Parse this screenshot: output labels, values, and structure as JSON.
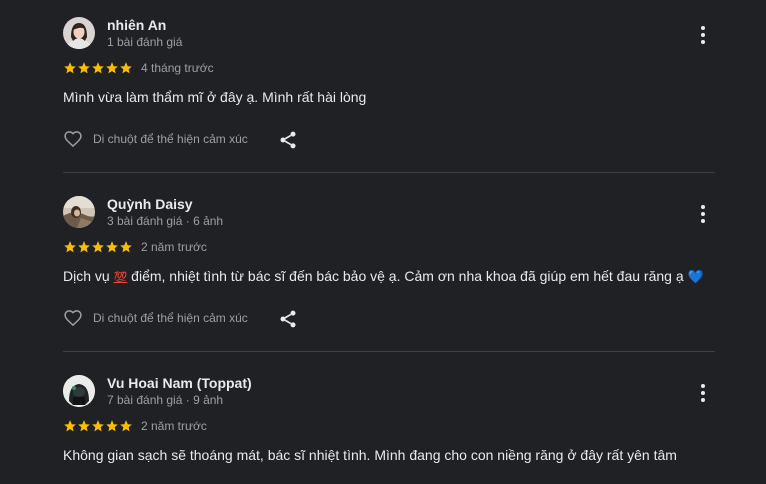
{
  "reviews": [
    {
      "author": "nhiên An",
      "meta": "1 bài đánh giá",
      "rating": 5,
      "date": "4 tháng trước",
      "text": "Mình vừa làm thẩm mĩ ở đây ạ. Mình rất hài lòng",
      "like_label": "Di chuột để thể hiện cảm xúc"
    },
    {
      "author": "Quỳnh Daisy",
      "meta": "3 bài đánh giá · 6 ảnh",
      "rating": 5,
      "date": "2 năm trước",
      "text_before": "Dịch vụ ",
      "emoji_1": "💯",
      "text_after": " điểm, nhiệt tình từ bác sĩ đến bác bảo vệ ạ. Cảm ơn nha khoa đã giúp em hết đau răng ạ ",
      "emoji_2": "💙",
      "like_label": "Di chuột để thể hiện cảm xúc"
    },
    {
      "author": "Vu Hoai Nam (Toppat)",
      "meta": "7 bài đánh giá · 9 ảnh",
      "rating": 5,
      "date": "2 năm trước",
      "text": "Không gian sạch sẽ thoáng mát, bác sĩ nhiệt tình. Mình đang cho con niềng răng ở đây rất yên tâm"
    }
  ],
  "colors": {
    "background": "#202124",
    "star": "#fbbc04",
    "text_primary": "#e8eaed",
    "text_secondary": "#9aa0a6",
    "divider": "#3c4043"
  },
  "icons": {
    "more": "more-vert-icon",
    "like": "heart-outline-icon",
    "share": "share-icon",
    "star": "star-icon"
  }
}
